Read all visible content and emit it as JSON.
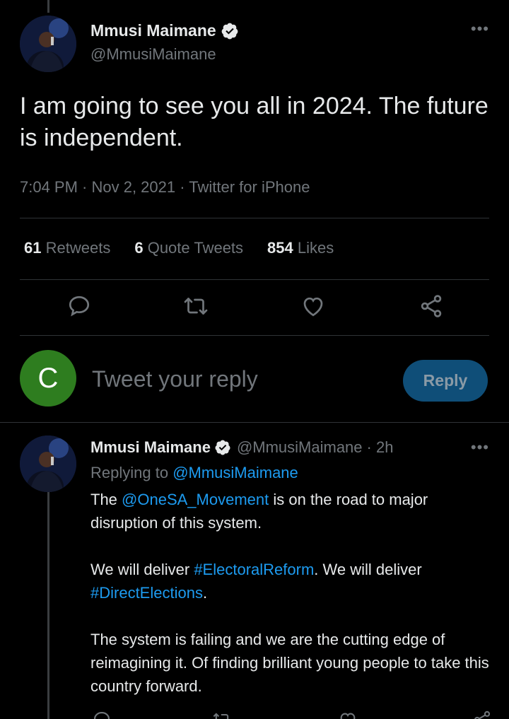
{
  "main_tweet": {
    "author_name": "Mmusi Maimane",
    "author_handle": "@MmusiMaimane",
    "more_label": "•••",
    "text": "I am going to see you all in 2024. The future is independent.",
    "meta": "7:04 PM · Nov 2, 2021 · Twitter for iPhone",
    "stats": {
      "retweets_count": "61",
      "retweets_label": "Retweets",
      "quotes_count": "6",
      "quotes_label": "Quote Tweets",
      "likes_count": "854",
      "likes_label": "Likes"
    },
    "actions": [
      "reply-icon",
      "retweet-icon",
      "like-icon",
      "share-icon"
    ]
  },
  "reply_composer": {
    "avatar_letter": "C",
    "placeholder": "Tweet your reply",
    "button_label": "Reply",
    "avatar_color": "#2e7d1f",
    "button_color": "#0f4e78"
  },
  "reply_tweet": {
    "author_name": "Mmusi Maimane",
    "author_handle": "@MmusiMaimane",
    "time": "· 2h",
    "more_label": "•••",
    "replying_prefix": "Replying to ",
    "replying_handle": "@MmusiMaimane",
    "p1_before": "The ",
    "p1_link": "@OneSA_Movement",
    "p1_after": " is on the road to major disruption of this system.",
    "p2_before": "We will deliver ",
    "p2_link1": "#ElectoralReform",
    "p2_mid": ". We will deliver ",
    "p2_link2": "#DirectElections",
    "p2_after": ".",
    "p3": "The system is failing and we are the cutting edge of reimagining it. Of finding brilliant young people to take this country forward."
  },
  "colors": {
    "background": "#000000",
    "text": "#e7e9ea",
    "muted": "#71767b",
    "link": "#1d9bf0",
    "divider": "#2f3336",
    "verified": "#1d9bf0"
  }
}
